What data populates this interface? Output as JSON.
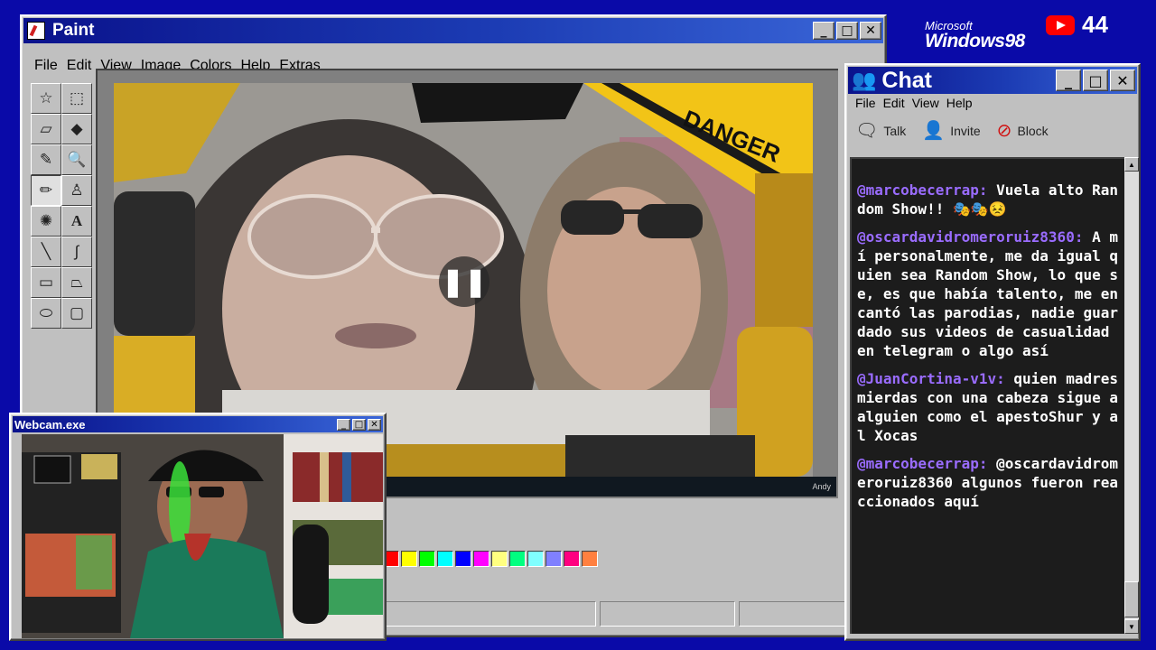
{
  "paint": {
    "title": "Paint",
    "menu": [
      "File",
      "Edit",
      "View",
      "Image",
      "Colors",
      "Help",
      "Extras"
    ],
    "tools": [
      "free-select",
      "rect-select",
      "eraser",
      "fill",
      "picker",
      "magnifier",
      "pencil",
      "brush",
      "airbrush",
      "text",
      "line",
      "curve",
      "rectangle",
      "polygon",
      "ellipse",
      "rounded-rect"
    ],
    "video": {
      "banner_text": "DANGER",
      "footer_text": "Andy"
    },
    "palette": [
      "#ff0000",
      "#ffff00",
      "#00ff00",
      "#00ffff",
      "#0000ff",
      "#ff00ff",
      "#ffff80",
      "#00ff80",
      "#80ffff",
      "#8080ff",
      "#ff0080",
      "#ff8040"
    ]
  },
  "webcam": {
    "title": "Webcam.exe"
  },
  "chat": {
    "title": "Chat",
    "menu": [
      "File",
      "Edit",
      "View",
      "Help"
    ],
    "toolbar": [
      "Talk",
      "Invite",
      "Block"
    ],
    "messages": [
      {
        "user": "@marcobecerrap:",
        "text": " Vuela alto Random Show!! 🎭🎭😣"
      },
      {
        "user": "@oscardavidromeroruiz8360:",
        "text": " A mí personalmente, me da igual quien sea Random Show, lo que se, es que había talento, me encantó las parodias, nadie guardado sus videos de casualidad en telegram o algo así"
      },
      {
        "user": "@JuanCortina-v1v:",
        "text": " quien madres mierdas con una cabeza sigue a alguien como el apestoShur y al Xocas"
      },
      {
        "user": "@marcobecerrap:",
        "text": " @oscardavidromeroruiz8360 algunos fueron reaccionados aquí"
      }
    ]
  },
  "branding": {
    "ms_small": "Microsoft",
    "ms_big": "Windows98",
    "yt_count": "44"
  }
}
